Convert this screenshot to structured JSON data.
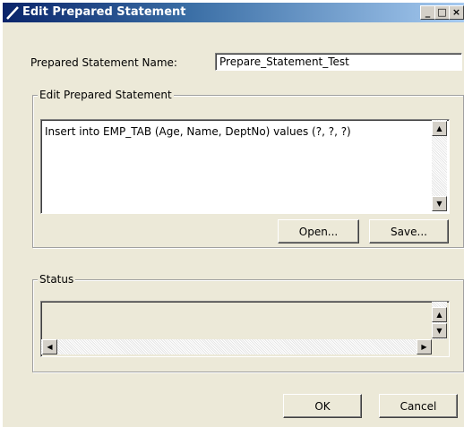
{
  "window": {
    "title": "Edit Prepared Statement",
    "controls": {
      "minimize": "_",
      "maximize": "□",
      "close": "×"
    }
  },
  "form": {
    "name_label": "Prepared Statement Name:",
    "name_value": "Prepare_Statement_Test"
  },
  "edit_group": {
    "legend": "Edit Prepared Statement",
    "statement_text": "Insert into EMP_TAB (Age, Name, DeptNo) values (?, ?, ?)",
    "open_label": "Open...",
    "save_label": "Save..."
  },
  "status_group": {
    "legend": "Status",
    "status_text": ""
  },
  "footer": {
    "ok_label": "OK",
    "cancel_label": "Cancel"
  },
  "icons": {
    "scroll_up": "▲",
    "scroll_down": "▼",
    "scroll_left": "◀",
    "scroll_right": "▶"
  }
}
